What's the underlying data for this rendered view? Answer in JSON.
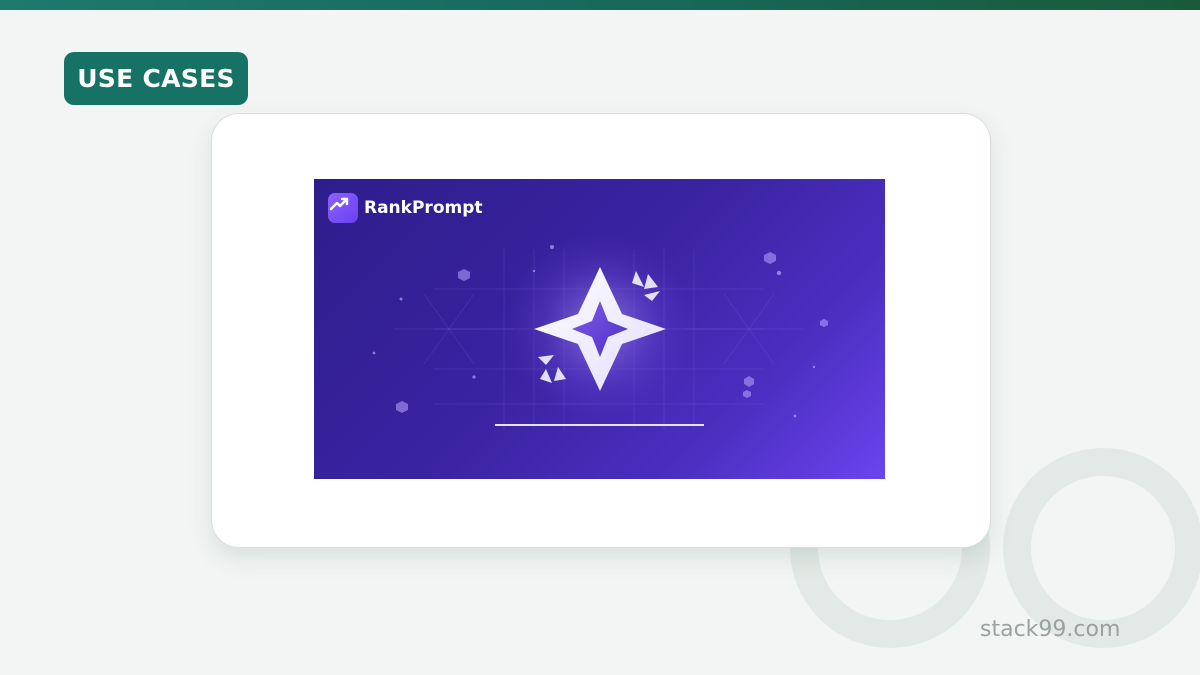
{
  "header": {
    "badge_label": "USE CASES"
  },
  "banner": {
    "brand_name": "RankPrompt"
  },
  "footer": {
    "watermark": "stack99.com"
  },
  "colors": {
    "accent_teal": "#157264",
    "banner_purple": "#3a23a0",
    "banner_violet": "#6b44ee"
  },
  "icons": [
    "trend-up-icon",
    "star-emblem-icon"
  ]
}
